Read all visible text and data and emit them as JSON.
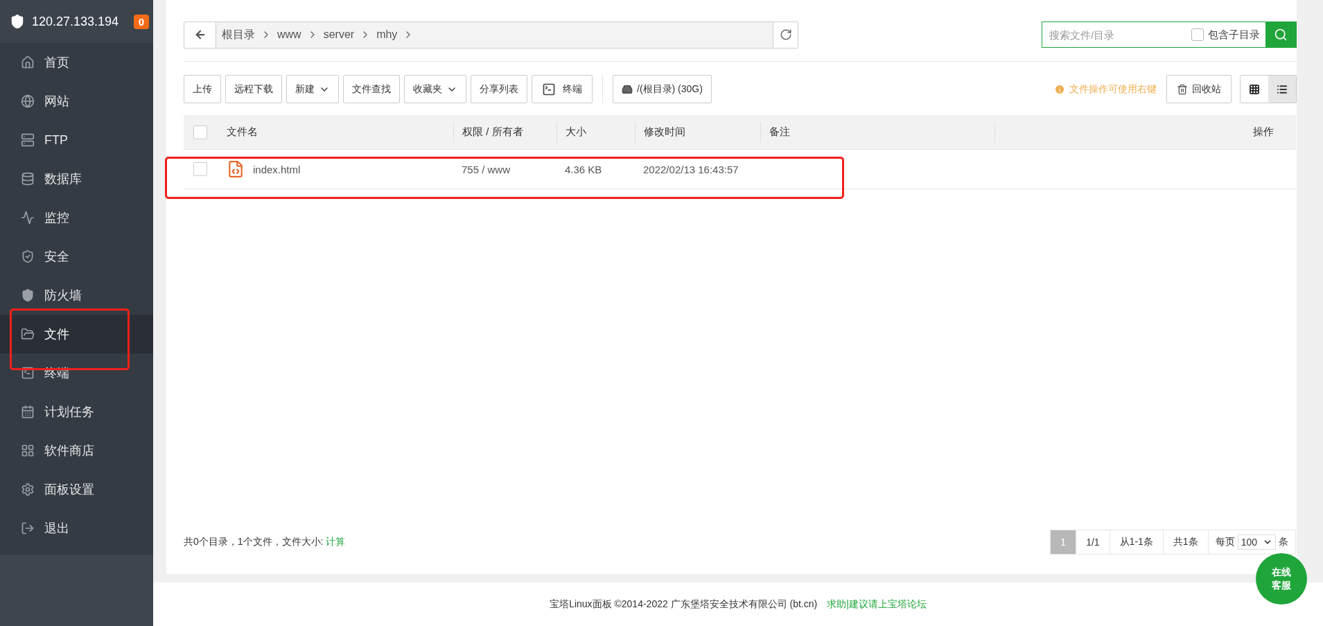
{
  "server": {
    "address": "120.27.133.194",
    "badge": "0"
  },
  "sidebar": {
    "items": [
      {
        "label": "首页",
        "kind": "home",
        "selected": false,
        "annotated": false
      },
      {
        "label": "网站",
        "kind": "globe",
        "selected": false,
        "annotated": false
      },
      {
        "label": "FTP",
        "kind": "ftp",
        "selected": false,
        "annotated": false
      },
      {
        "label": "数据库",
        "kind": "database",
        "selected": false,
        "annotated": false
      },
      {
        "label": "监控",
        "kind": "monitor",
        "selected": false,
        "annotated": false
      },
      {
        "label": "安全",
        "kind": "security",
        "selected": false,
        "annotated": false
      },
      {
        "label": "防火墙",
        "kind": "firewall",
        "selected": false,
        "annotated": false
      },
      {
        "label": "文件",
        "kind": "folder",
        "selected": true,
        "annotated": true
      },
      {
        "label": "终端",
        "kind": "terminal",
        "selected": false,
        "annotated": false
      },
      {
        "label": "计划任务",
        "kind": "calendar",
        "selected": false,
        "annotated": false
      },
      {
        "label": "软件商店",
        "kind": "apps",
        "selected": false,
        "annotated": false
      },
      {
        "label": "面板设置",
        "kind": "settings",
        "selected": false,
        "annotated": false
      },
      {
        "label": "退出",
        "kind": "logout",
        "selected": false,
        "annotated": false
      }
    ]
  },
  "path": {
    "crumbs": [
      "根目录",
      "www",
      "server",
      "mhy"
    ]
  },
  "search": {
    "placeholder": "搜索文件/目录",
    "subdir_label": "包含子目录",
    "subdir_checked": false
  },
  "toolbar": {
    "buttons": [
      {
        "label": "上传",
        "kind": "plain"
      },
      {
        "label": "远程下载",
        "kind": "plain"
      },
      {
        "label": "新建",
        "kind": "dropdown"
      },
      {
        "label": "文件查找",
        "kind": "plain"
      },
      {
        "label": "收藏夹",
        "kind": "dropdown"
      },
      {
        "label": "分享列表",
        "kind": "plain"
      },
      {
        "label": "终端",
        "kind": "terminal"
      },
      {
        "label": "/(根目录) (30G)",
        "kind": "disk"
      }
    ],
    "hint": "文件操作可使用右键",
    "recycle": "回收站",
    "views": [
      {
        "kind": "grid",
        "selected": false
      },
      {
        "kind": "list",
        "selected": true
      }
    ]
  },
  "table": {
    "select_all_checked": false,
    "columns": [
      "文件名",
      "权限 / 所有者",
      "大小",
      "修改时间",
      "备注",
      "操作"
    ],
    "rows": [
      {
        "name": "index.html",
        "permissions": "755 / www",
        "size": "4.36 KB",
        "modified": "2022/02/13 16:43:57",
        "checked": false,
        "annotated": true
      }
    ]
  },
  "summary": {
    "text": "共0个目录，1个文件，文件大小: ",
    "link": "计算"
  },
  "pagination": {
    "current": "1",
    "pages": "1/1",
    "range": "从1-1条",
    "total": "共1条",
    "per_page_label": "每页",
    "per_page": "100",
    "unit": "条"
  },
  "footer": {
    "copyright": "宝塔Linux面板 ©2014-2022 广东堡塔安全技术有限公司 (bt.cn)",
    "link": "求助|建议请上宝塔论坛"
  },
  "chat_button": "在线客服"
}
